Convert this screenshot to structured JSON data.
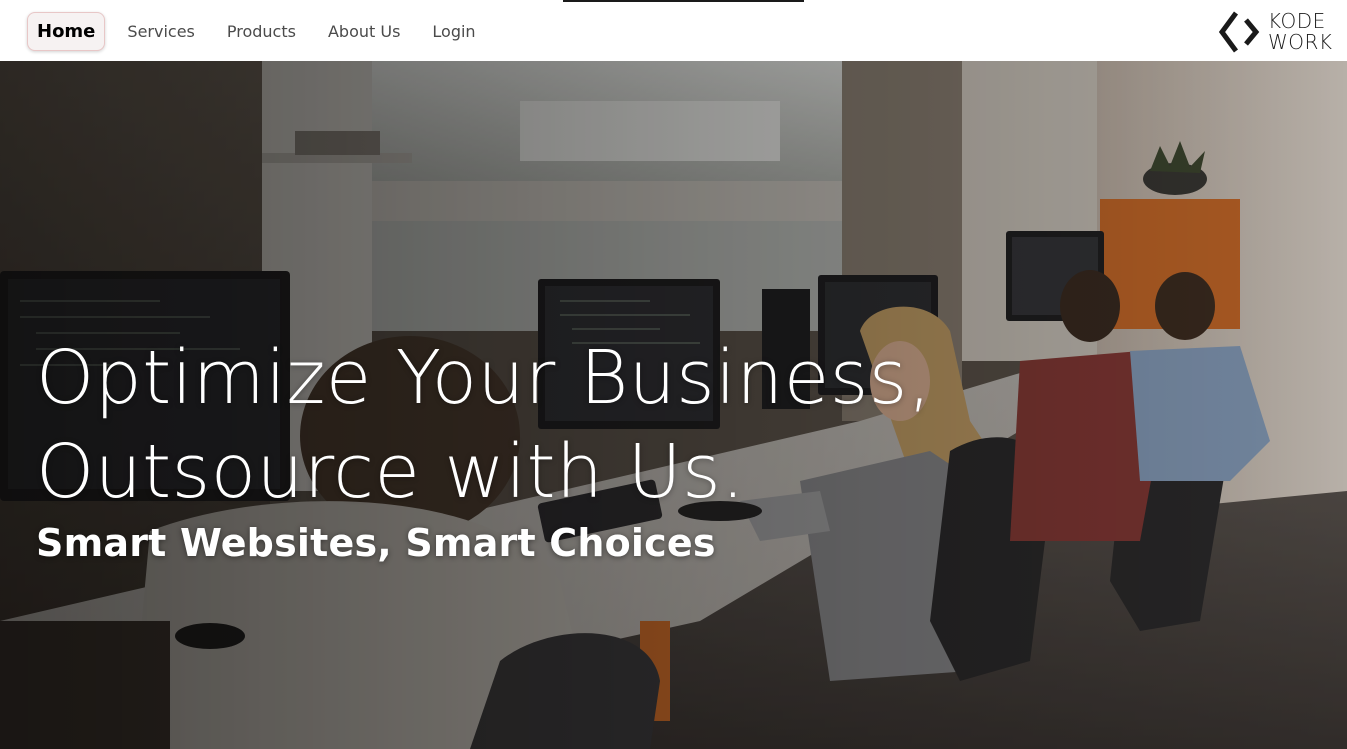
{
  "nav": {
    "items": [
      {
        "label": "Home",
        "active": true
      },
      {
        "label": "Services",
        "active": false
      },
      {
        "label": "Products",
        "active": false
      },
      {
        "label": "About Us",
        "active": false
      },
      {
        "label": "Login",
        "active": false
      }
    ]
  },
  "brand": {
    "line1": "KODE",
    "line2": "WORK",
    "icon": "code-brackets-icon"
  },
  "hero": {
    "headline_line1": "Optimize Your Business,",
    "headline_line2": "Outsource with Us.",
    "tagline": "Smart Websites, Smart Choices",
    "image": "office-workers-photo"
  },
  "colors": {
    "accent_chair": "#d46f2a",
    "text_on_hero": "#ffffff",
    "nav_text": "#4b4b4b"
  }
}
